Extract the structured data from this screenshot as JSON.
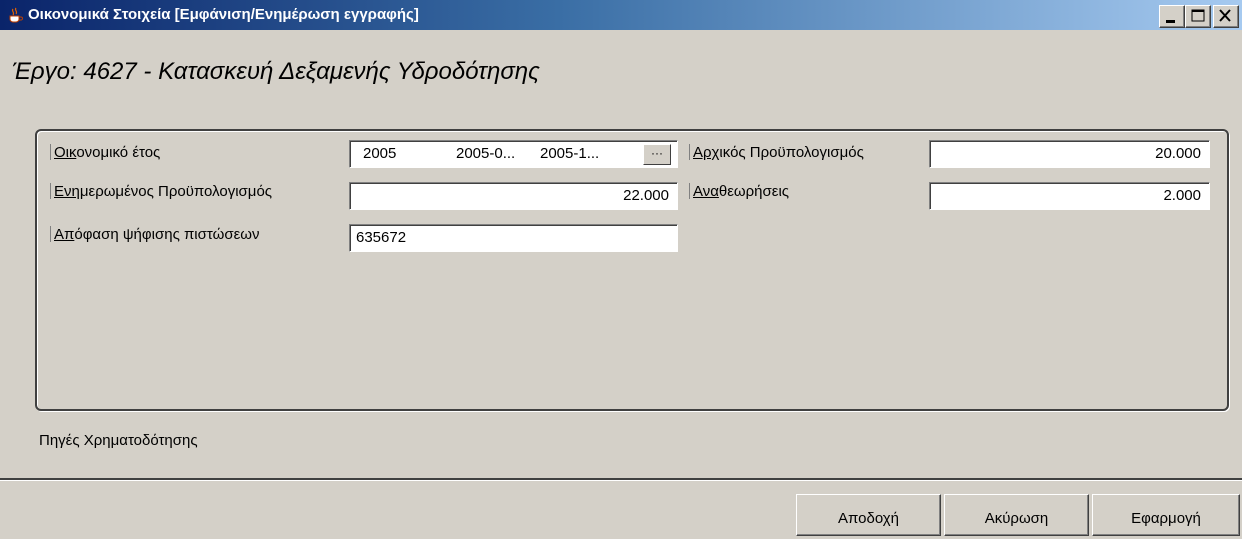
{
  "window": {
    "title": "Οικονομικά Στοιχεία [Εμφάνιση/Ενημέρωση  εγγραφής]",
    "app_icon": "java-cup-icon",
    "controls": [
      "minimize-icon",
      "maximize-icon",
      "close-icon"
    ]
  },
  "heading": "Έργο: 4627 - Κατασκευή Δεξαμενής Υδροδότησης",
  "form": {
    "fiscal_year": {
      "label_mnemonic": "Οικ",
      "label_rest": "ονομικό έτος",
      "year": "2005",
      "start": "2005-0...",
      "end": "2005-1...",
      "picker_label": "···"
    },
    "initial_budget": {
      "label_mnemonic": "Αρχ",
      "label_rest": "ικός Προϋπολογισμός",
      "value": "20.000"
    },
    "updated_budget": {
      "label_mnemonic": "Ενη",
      "label_rest": "μερωμένος Προϋπολογισμός",
      "value": "22.000"
    },
    "revisions": {
      "label_mnemonic": "Ανα",
      "label_rest": "θεωρήσεις",
      "value": "2.000"
    },
    "credit_decision": {
      "label_mnemonic": "Απ",
      "label_rest": "όφαση ψήφισης πιστώσεων",
      "value": "635672"
    }
  },
  "funding_sources_label": "Πηγές Χρηματοδότησης",
  "buttons": {
    "accept": "Αποδοχή",
    "cancel": "Ακύρωση",
    "apply": "Εφαρμογή"
  },
  "colors": {
    "titlebar_start": "#0a246a",
    "titlebar_end": "#a6caf0",
    "window_bg": "#d4d0c8"
  }
}
